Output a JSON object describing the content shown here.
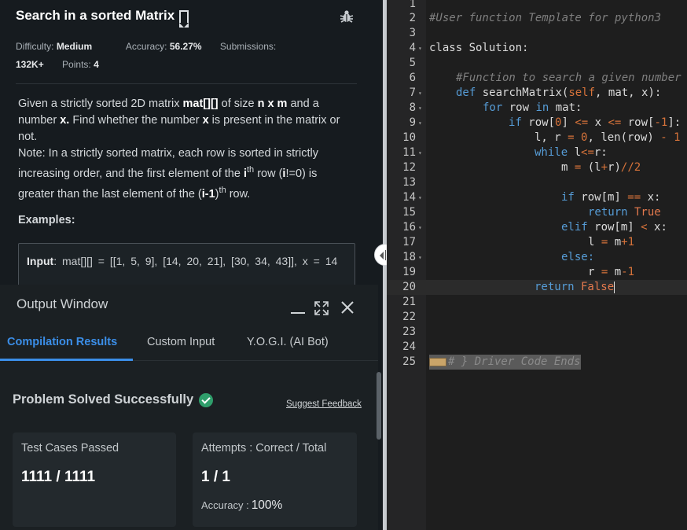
{
  "problem": {
    "title": "Search in a sorted Matrix",
    "difficulty_label": "Difficulty:",
    "difficulty": "Medium",
    "accuracy_label": "Accuracy:",
    "accuracy": "56.27%",
    "submissions_label": "Submissions:",
    "submissions": "132K+",
    "points_label": "Points:",
    "points": "4",
    "desc_1a": "Given a strictly sorted 2D matrix ",
    "desc_1b": "mat[][]",
    "desc_1c": " of size ",
    "desc_1d": "n x m",
    "desc_1e": " and a number ",
    "desc_1f": "x.",
    "desc_1g": " Find whether the number ",
    "desc_1h": "x",
    "desc_1i": " is present in the matrix or not.",
    "desc_2a": "Note: In a strictly sorted matrix, each row is sorted in strictly increasing order, and the first element of the ",
    "desc_2b": "i",
    "desc_2c": "th",
    "desc_2d": " row (",
    "desc_2e": "i",
    "desc_2f": "!=0) is greater than the last element of the (",
    "desc_2g": "i-1",
    "desc_2h": ")",
    "desc_2i": "th",
    "desc_2j": " row.",
    "examples_heading": "Examples:",
    "example_input_label": "Input",
    "example_input_text": ": mat[][] = [[1, 5, 9], [14, 20, 21], [30, 34, 43]], x = 14"
  },
  "output_window": {
    "title": "Output Window",
    "tabs": [
      {
        "label": "Compilation Results"
      },
      {
        "label": "Custom Input"
      },
      {
        "label": "Y.O.G.I. (AI Bot)"
      }
    ],
    "status": "Problem Solved Successfully",
    "feedback_link": "Suggest Feedback",
    "test_cases_label": "Test Cases Passed",
    "test_cases_value": "1111 / 1111",
    "attempts_label": "Attempts : Correct / Total",
    "attempts_value": "1 / 1",
    "accuracy_label": "Accuracy :",
    "accuracy_value": "100%"
  },
  "editor": {
    "line_numbers": [
      "1",
      "2",
      "3",
      "4",
      "5",
      "6",
      "7",
      "8",
      "9",
      "10",
      "11",
      "12",
      "13",
      "14",
      "15",
      "16",
      "17",
      "18",
      "19",
      "20",
      "21",
      "22",
      "23",
      "24",
      "25"
    ],
    "active_line": 20,
    "line_2": "#User function Template for python3",
    "line_4": "class Solution:",
    "line_6": "#Function to search a given number",
    "line_7a": "def",
    "line_7b": " searchMatrix(",
    "line_7c": "self",
    "line_7d": ", mat, x):",
    "line_8a": "for",
    "line_8b": " row ",
    "line_8c": "in",
    "line_8d": " mat:",
    "line_9a": "if",
    "line_9b": " row[",
    "line_9c": "0",
    "line_9d": "] ",
    "line_9e": "<=",
    "line_9f": " x ",
    "line_9g": "<=",
    "line_9h": " row[",
    "line_9i": "-1",
    "line_9j": "]:",
    "line_10a": "l, r ",
    "line_10b": "=",
    "line_10c": " ",
    "line_10d": "0",
    "line_10e": ", len(row) ",
    "line_10f": "-",
    "line_10g": " ",
    "line_10h": "1",
    "line_11a": "while",
    "line_11b": " l",
    "line_11c": "<=",
    "line_11d": "r:",
    "line_12a": "m ",
    "line_12b": "=",
    "line_12c": " (l",
    "line_12d": "+",
    "line_12e": "r)",
    "line_12f": "//",
    "line_12g": "2",
    "line_14a": "if",
    "line_14b": " row[m] ",
    "line_14c": "==",
    "line_14d": " x:",
    "line_15a": "return",
    "line_15b": " True",
    "line_16a": "elif",
    "line_16b": " row[m] ",
    "line_16c": "<",
    "line_16d": " x:",
    "line_17a": "l ",
    "line_17b": "=",
    "line_17c": " m",
    "line_17d": "+",
    "line_17e": "1",
    "line_18": "else:",
    "line_19a": "r ",
    "line_19b": "=",
    "line_19c": " m",
    "line_19d": "-",
    "line_19e": "1",
    "line_20a": "return",
    "line_20b": " False",
    "line_25": "# } Driver Code Ends"
  },
  "icons": {
    "bookmark": "bookmark-icon",
    "bug": "bug-icon",
    "minimize": "minimize-icon",
    "expand": "expand-icon",
    "close": "close-icon",
    "check": "check-circle-icon",
    "resize": "resize-handle-icon"
  },
  "colors": {
    "accent_blue": "#3b8ee8",
    "success_green": "#2f9e6b",
    "keyword": "#569cd6",
    "literal": "#d7733a"
  }
}
